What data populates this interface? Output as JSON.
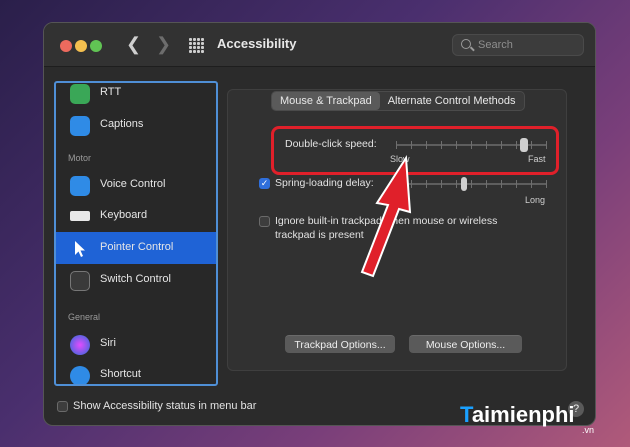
{
  "window": {
    "title": "Accessibility"
  },
  "search": {
    "placeholder": "Search"
  },
  "sidebar": {
    "items": [
      {
        "label": "RTT"
      },
      {
        "label": "Captions"
      },
      {
        "label": "Voice Control"
      },
      {
        "label": "Keyboard"
      },
      {
        "label": "Pointer Control"
      },
      {
        "label": "Switch Control"
      },
      {
        "label": "Siri"
      },
      {
        "label": "Shortcut"
      }
    ],
    "sections": {
      "motor": "Motor",
      "general": "General"
    },
    "selected": "Pointer Control"
  },
  "tabs": [
    {
      "label": "Mouse & Trackpad",
      "active": true
    },
    {
      "label": "Alternate Control Methods",
      "active": false
    }
  ],
  "settings": {
    "double_click_label": "Double-click speed:",
    "double_click_min": "Slow",
    "double_click_max": "Fast",
    "double_click_value": 0.85,
    "spring_loading_label": "Spring-loading delay:",
    "spring_loading_checked": true,
    "spring_loading_max": "Long",
    "spring_loading_value": 0.45,
    "ignore_trackpad_label_line1": "Ignore built-in trackpad when mouse or wireless",
    "ignore_trackpad_label_line2": "trackpad is present",
    "ignore_trackpad_checked": false
  },
  "buttons": {
    "trackpad_options": "Trackpad Options...",
    "mouse_options": "Mouse Options..."
  },
  "footer": {
    "show_status_label": "Show Accessibility status in menu bar",
    "help": "?"
  },
  "watermark": {
    "brand_initial": "T",
    "brand_rest": "aimienphi",
    "domain": ".vn"
  },
  "colors": {
    "accent": "#1f63d6",
    "highlight": "#e0202a",
    "arrow": "#e0202a"
  }
}
